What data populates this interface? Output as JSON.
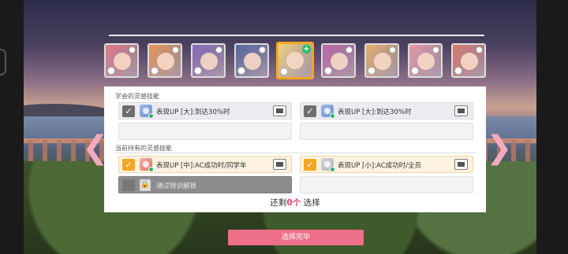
{
  "colors": {
    "accent_pink": "#ee6f89",
    "remain_count_pink": "#e8406a",
    "selected_border": "#f5a623",
    "check_orange": "#f5a623",
    "panel_bg": "#ffffff"
  },
  "cards": [
    {
      "fill": "#e07a8a"
    },
    {
      "fill": "#e8985a"
    },
    {
      "fill": "#8a6ab8"
    },
    {
      "fill": "#5a6aa0"
    },
    {
      "fill": "#f2d48a",
      "selected": true
    },
    {
      "fill": "#c06aa8"
    },
    {
      "fill": "#e8b070"
    },
    {
      "fill": "#e89aa8"
    },
    {
      "fill": "#d87a70"
    }
  ],
  "learned": {
    "label": "学会的灵感技能",
    "slots": [
      {
        "text": "表现UP [大]:到达30%时"
      },
      {
        "text": "表现UP [大]:到达30%时"
      }
    ]
  },
  "current": {
    "label": "当前持有的灵感技能",
    "slots": [
      {
        "text": "表现UP [中]:AC成功时/同学年"
      },
      {
        "text": "表现UP [小]:AC成功时/全员"
      }
    ],
    "locked_text": "通过特训解锁"
  },
  "remain": {
    "prefix": "还剩",
    "count": "0个",
    "suffix": " 选择"
  },
  "confirm_label": "选择完毕",
  "glyphs": {
    "check": "✓",
    "arrow_left": "❮",
    "arrow_right": "❯",
    "lock": "🔒",
    "plus": "+"
  }
}
